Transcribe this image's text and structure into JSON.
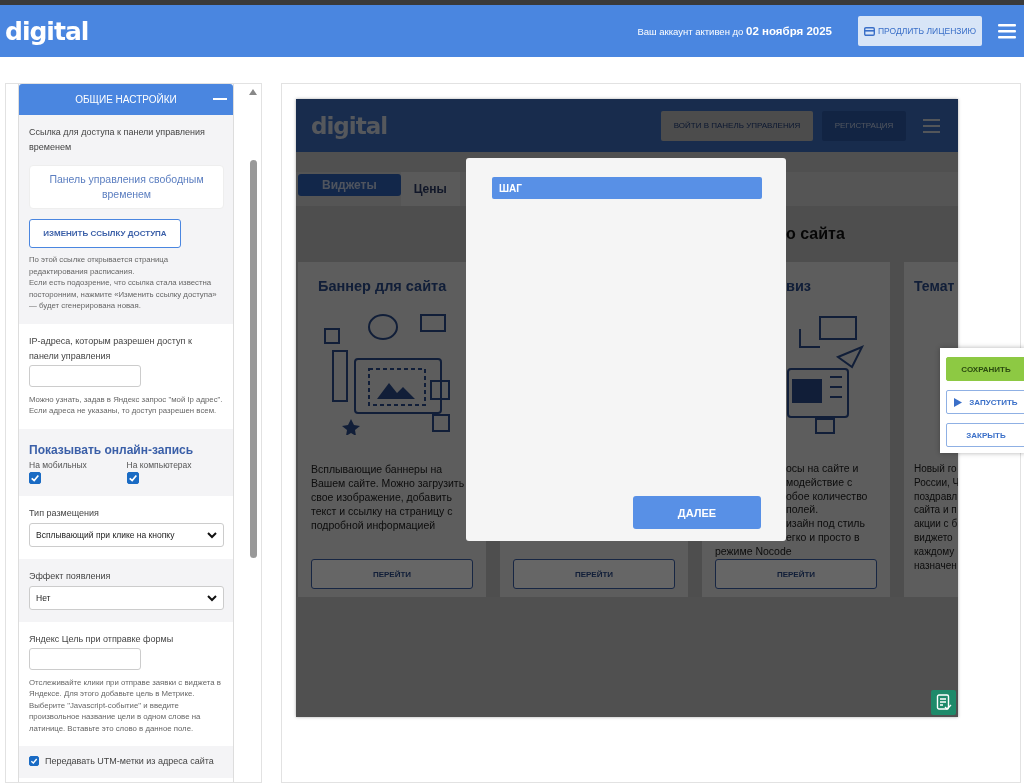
{
  "top_bar": {
    "logo": "digital",
    "account_status": "Ваш аккаунт активен до **02 ноября 2025**",
    "renew_button": "ПРОДЛИТЬ ЛИЦЕНЗИЮ"
  },
  "settings_panel": {
    "header": "ОБЩИЕ НАСТРОЙКИ",
    "expanded": true,
    "sections": [
      {
        "kind": "link",
        "label": "Ссылка для доступа к панели управления временем",
        "link": "Панель управления свободным временем",
        "button": "ИЗМЕНИТЬ ССЫЛКУ ДОСТУПА",
        "help": [
          "По этой ссылке открывается страница редактирования расписания.",
          "Если есть подозрение, что ссылка стала известна посторонним, нажмите «Изменить ссылку доступа» — будет сгенерирована новая."
        ]
      },
      {
        "kind": "input",
        "label": "IP-адреса, которым разрешен доступ к панели управления",
        "help": [
          "Можно узнать, задав в Яндекс запрос \"мой Ip адрес\". Если адреса не указаны, то доступ разрешен всем."
        ]
      },
      {
        "kind": "toggles",
        "title": "Показывать онлайн-запись",
        "options": [
          {
            "label": "На мобильных",
            "checked": true
          },
          {
            "label": "На компьютерах",
            "checked": true
          }
        ]
      },
      {
        "kind": "select",
        "label": "Тип размещения",
        "value": "Всплывающий при клике на кнопку"
      },
      {
        "kind": "select",
        "label": "Эффект появления",
        "value": "Нет"
      },
      {
        "kind": "input",
        "label": "Яндекс Цель при отправке формы",
        "help": [
          "Отслеживайте клики при отправе заявки с виджета в Яндексе. Для этого добавьте цель в Метрике. Выберите \"Javascript-событие\" и введите произвольное название цели в одном слове на латинице. Вставьте это слово в данное поле."
        ]
      },
      {
        "kind": "checkbox",
        "label": "Передавать UTM-метки из адреса сайта",
        "checked": true
      }
    ]
  },
  "preview": {
    "site_header": {
      "logo": "digital",
      "buttons": [
        {
          "label": "ВОЙТИ В ПАНЕЛЬ УПРАВЛЕНИЯ",
          "kind": "light"
        },
        {
          "label": "РЕГИСТРАЦИЯ",
          "kind": "dark"
        }
      ]
    },
    "tabs": [
      {
        "label": "Виджеты",
        "selected": true
      },
      {
        "label": "Цены",
        "selected": false
      }
    ],
    "heading": "о сайта",
    "cards": [
      {
        "title": "Баннер для сайта",
        "text": "Всплывающие баннеры на Вашем сайте. Можно загрузить свое изображение, добавить текст и ссылку на страницу с подробной информацией",
        "button": "ПЕРЕЙТИ"
      },
      {
        "button": "ПЕРЕЙТИ"
      },
      {
        "title": "виз",
        "lines": [
          "осы на сайте и",
          "модействие с",
          "обое количество",
          "полей.",
          "изайн под стиль",
          "егко и просто в",
          "режиме Nocode"
        ],
        "button": "ПЕРЕЙТИ"
      },
      {
        "title": "Темат",
        "lines": [
          "Новый го",
          "России, Ч",
          "поздравл",
          "сайта и п",
          "акции с б",
          "виджето",
          "каждому",
          "назначен"
        ]
      }
    ],
    "modal": {
      "step_label": "ШАГ",
      "next_button": "ДАЛЕЕ"
    }
  },
  "actions": [
    {
      "label": "СОХРАНИТЬ",
      "kind": "primary"
    },
    {
      "label": "ЗАПУСТИТЬ",
      "kind": "run"
    },
    {
      "label": "ЗАКРЫТЬ",
      "kind": "plain"
    }
  ]
}
